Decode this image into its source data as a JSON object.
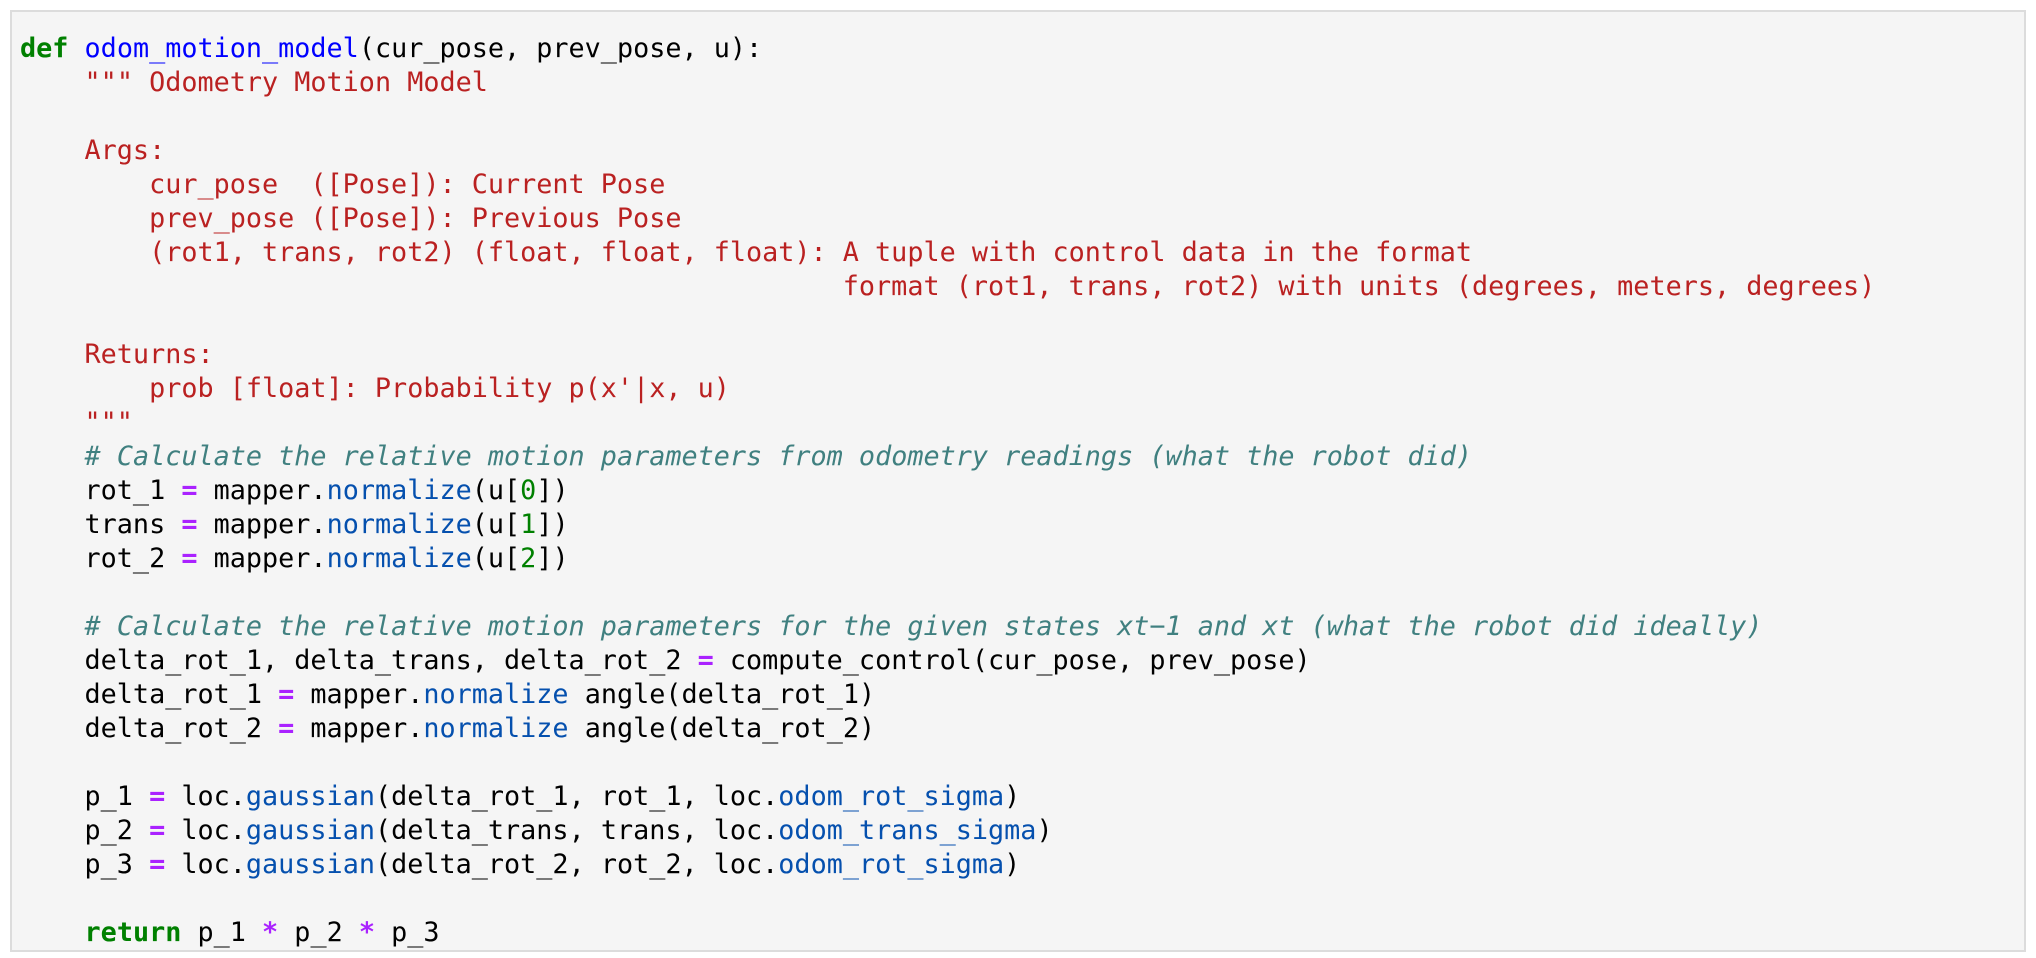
{
  "cell": {
    "lines": [
      [
        {
          "t": "kw",
          "v": "def"
        },
        {
          "t": "plain",
          "v": " "
        },
        {
          "t": "fn",
          "v": "odom_motion_model"
        },
        {
          "t": "plain",
          "v": "(cur_pose, prev_pose, u):"
        }
      ],
      [
        {
          "t": "plain",
          "v": "    "
        },
        {
          "t": "str",
          "v": "\"\"\" Odometry Motion Model"
        }
      ],
      [],
      [
        {
          "t": "str",
          "v": "    Args:"
        }
      ],
      [
        {
          "t": "str",
          "v": "        cur_pose  ([Pose]): Current Pose"
        }
      ],
      [
        {
          "t": "str",
          "v": "        prev_pose ([Pose]): Previous Pose"
        }
      ],
      [
        {
          "t": "str",
          "v": "        (rot1, trans, rot2) (float, float, float): A tuple with control data in the format"
        }
      ],
      [
        {
          "t": "str",
          "v": "                                                   format (rot1, trans, rot2) with units (degrees, meters, degrees)"
        }
      ],
      [],
      [
        {
          "t": "str",
          "v": "    Returns:"
        }
      ],
      [
        {
          "t": "str",
          "v": "        prob [float]: Probability p(x'|x, u)"
        }
      ],
      [
        {
          "t": "str",
          "v": "    \"\"\""
        }
      ],
      [
        {
          "t": "plain",
          "v": "    "
        },
        {
          "t": "cm",
          "v": "# Calculate the relative motion parameters from odometry readings (what the robot did)"
        }
      ],
      [
        {
          "t": "plain",
          "v": "    rot_1 "
        },
        {
          "t": "op",
          "v": "="
        },
        {
          "t": "plain",
          "v": " mapper."
        },
        {
          "t": "attr",
          "v": "normalize"
        },
        {
          "t": "plain",
          "v": "(u["
        },
        {
          "t": "num",
          "v": "0"
        },
        {
          "t": "plain",
          "v": "])"
        }
      ],
      [
        {
          "t": "plain",
          "v": "    trans "
        },
        {
          "t": "op",
          "v": "="
        },
        {
          "t": "plain",
          "v": " mapper."
        },
        {
          "t": "attr",
          "v": "normalize"
        },
        {
          "t": "plain",
          "v": "(u["
        },
        {
          "t": "num",
          "v": "1"
        },
        {
          "t": "plain",
          "v": "])"
        }
      ],
      [
        {
          "t": "plain",
          "v": "    rot_2 "
        },
        {
          "t": "op",
          "v": "="
        },
        {
          "t": "plain",
          "v": " mapper."
        },
        {
          "t": "attr",
          "v": "normalize"
        },
        {
          "t": "plain",
          "v": "(u["
        },
        {
          "t": "num",
          "v": "2"
        },
        {
          "t": "plain",
          "v": "])"
        }
      ],
      [],
      [
        {
          "t": "plain",
          "v": "    "
        },
        {
          "t": "cm",
          "v": "# Calculate the relative motion parameters for the given states xt−1 and xt (what the robot did ideally)"
        }
      ],
      [
        {
          "t": "plain",
          "v": "    delta_rot_1, delta_trans, delta_rot_2 "
        },
        {
          "t": "op",
          "v": "="
        },
        {
          "t": "plain",
          "v": " compute_control(cur_pose, prev_pose)"
        }
      ],
      [
        {
          "t": "plain",
          "v": "    delta_rot_1 "
        },
        {
          "t": "op",
          "v": "="
        },
        {
          "t": "plain",
          "v": " mapper."
        },
        {
          "t": "attr",
          "v": "normalize"
        },
        {
          "t": "plain",
          "v": " angle(delta_rot_1)"
        }
      ],
      [
        {
          "t": "plain",
          "v": "    delta_rot_2 "
        },
        {
          "t": "op",
          "v": "="
        },
        {
          "t": "plain",
          "v": " mapper."
        },
        {
          "t": "attr",
          "v": "normalize"
        },
        {
          "t": "plain",
          "v": " angle(delta_rot_2)"
        }
      ],
      [],
      [
        {
          "t": "plain",
          "v": "    p_1 "
        },
        {
          "t": "op",
          "v": "="
        },
        {
          "t": "plain",
          "v": " loc."
        },
        {
          "t": "attr",
          "v": "gaussian"
        },
        {
          "t": "plain",
          "v": "(delta_rot_1, rot_1, loc."
        },
        {
          "t": "attr",
          "v": "odom_rot_sigma"
        },
        {
          "t": "plain",
          "v": ")"
        }
      ],
      [
        {
          "t": "plain",
          "v": "    p_2 "
        },
        {
          "t": "op",
          "v": "="
        },
        {
          "t": "plain",
          "v": " loc."
        },
        {
          "t": "attr",
          "v": "gaussian"
        },
        {
          "t": "plain",
          "v": "(delta_trans, trans, loc."
        },
        {
          "t": "attr",
          "v": "odom_trans_sigma"
        },
        {
          "t": "plain",
          "v": ")"
        }
      ],
      [
        {
          "t": "plain",
          "v": "    p_3 "
        },
        {
          "t": "op",
          "v": "="
        },
        {
          "t": "plain",
          "v": " loc."
        },
        {
          "t": "attr",
          "v": "gaussian"
        },
        {
          "t": "plain",
          "v": "(delta_rot_2, rot_2, loc."
        },
        {
          "t": "attr",
          "v": "odom_rot_sigma"
        },
        {
          "t": "plain",
          "v": ")"
        }
      ],
      [],
      [
        {
          "t": "plain",
          "v": "    "
        },
        {
          "t": "kw",
          "v": "return"
        },
        {
          "t": "plain",
          "v": " p_1 "
        },
        {
          "t": "op",
          "v": "*"
        },
        {
          "t": "plain",
          "v": " p_2 "
        },
        {
          "t": "op",
          "v": "*"
        },
        {
          "t": "plain",
          "v": " p_3"
        }
      ]
    ]
  },
  "colors": {
    "keyword": "#008000",
    "function": "#0000ff",
    "string": "#ba2121",
    "comment": "#408080",
    "operator": "#aa22ff",
    "number": "#008000",
    "attribute": "#0550ae",
    "background": "#f5f5f5",
    "border": "#dcdcdc"
  }
}
